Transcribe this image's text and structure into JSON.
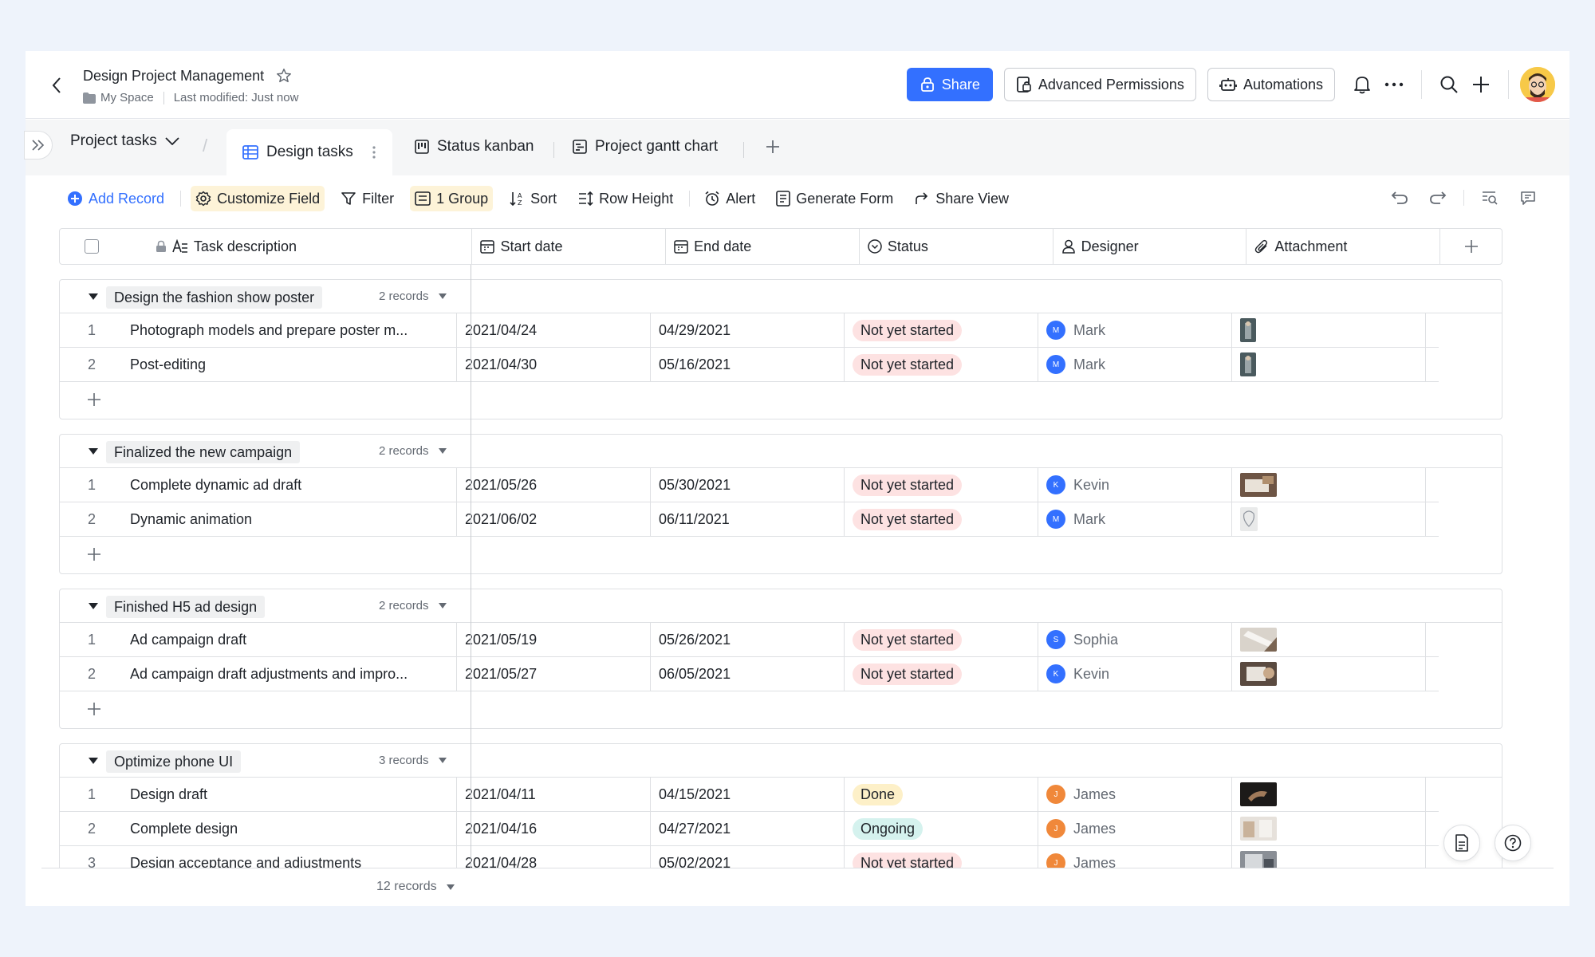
{
  "header": {
    "title": "Design Project Management",
    "location": "My Space",
    "last_modified": "Last modified: Just now",
    "share_label": "Share",
    "permissions_label": "Advanced Permissions",
    "automations_label": "Automations"
  },
  "tabs": {
    "project": "Project tasks",
    "items": [
      "Design tasks",
      "Status kanban",
      "Project gantt chart"
    ]
  },
  "toolbar": {
    "add_record": "Add Record",
    "customize_field": "Customize Field",
    "filter": "Filter",
    "group": "1 Group",
    "sort": "Sort",
    "row_height": "Row Height",
    "alert": "Alert",
    "generate_form": "Generate Form",
    "share_view": "Share View"
  },
  "columns": [
    "Task description",
    "Start date",
    "End date",
    "Status",
    "Designer",
    "Attachment"
  ],
  "groups": [
    {
      "title": "Design the fashion show poster",
      "count": "2 records",
      "rows": [
        {
          "idx": "1",
          "desc": "Photograph models and prepare poster m...",
          "start": "2021/04/24",
          "end": "04/29/2021",
          "status": "Not yet started",
          "designer": "Mark",
          "initial": "M"
        },
        {
          "idx": "2",
          "desc": "Post-editing",
          "start": "2021/04/30",
          "end": "05/16/2021",
          "status": "Not yet started",
          "designer": "Mark",
          "initial": "M"
        }
      ]
    },
    {
      "title": "Finalized the new campaign",
      "count": "2 records",
      "rows": [
        {
          "idx": "1",
          "desc": "Complete dynamic ad draft",
          "start": "2021/05/26",
          "end": "05/30/2021",
          "status": "Not yet started",
          "designer": "Kevin",
          "initial": "K"
        },
        {
          "idx": "2",
          "desc": "Dynamic animation",
          "start": "2021/06/02",
          "end": "06/11/2021",
          "status": "Not yet started",
          "designer": "Mark",
          "initial": "M"
        }
      ]
    },
    {
      "title": "Finished H5 ad design",
      "count": "2 records",
      "rows": [
        {
          "idx": "1",
          "desc": "Ad campaign draft",
          "start": "2021/05/19",
          "end": "05/26/2021",
          "status": "Not yet started",
          "designer": "Sophia",
          "initial": "S"
        },
        {
          "idx": "2",
          "desc": "Ad campaign draft adjustments and impro...",
          "start": "2021/05/27",
          "end": "06/05/2021",
          "status": "Not yet started",
          "designer": "Kevin",
          "initial": "K"
        }
      ]
    },
    {
      "title": "Optimize phone UI",
      "count": "3 records",
      "rows": [
        {
          "idx": "1",
          "desc": "Design draft",
          "start": "2021/04/11",
          "end": "04/15/2021",
          "status": "Done",
          "designer": "James",
          "initial": "J"
        },
        {
          "idx": "2",
          "desc": "Complete design",
          "start": "2021/04/16",
          "end": "04/27/2021",
          "status": "Ongoing",
          "designer": "James",
          "initial": "J"
        },
        {
          "idx": "3",
          "desc": "Design acceptance and adjustments",
          "start": "2021/04/28",
          "end": "05/02/2021",
          "status": "Not yet started",
          "designer": "James",
          "initial": "J"
        }
      ]
    }
  ],
  "footer": {
    "total": "12 records"
  },
  "colors": {
    "accent": "#3370ff",
    "status_not_started": "#fde2e2",
    "status_done": "#fdf0c8",
    "status_ongoing": "#d5f2ee"
  }
}
